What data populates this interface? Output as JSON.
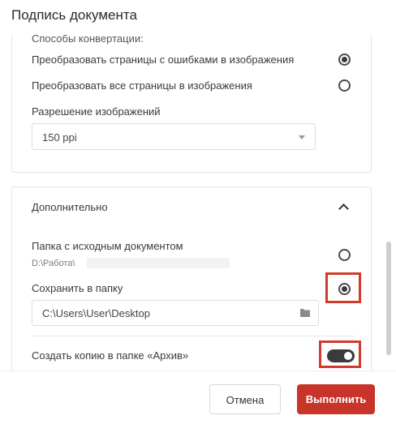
{
  "dialog": {
    "title": "Подпись документа"
  },
  "conversion": {
    "section_label": "Способы конвертации:",
    "option_errors": "Преобразовать страницы с ошибками в изображения",
    "option_errors_selected": true,
    "option_all": "Преобразовать все страницы в изображения",
    "option_all_selected": false,
    "resolution_label": "Разрешение изображений",
    "resolution_value": "150 ppi"
  },
  "additional": {
    "header": "Дополнительно",
    "expanded": true,
    "source_folder_label": "Папка с исходным документом",
    "source_folder_path": "D:\\Работа\\",
    "source_folder_selected": false,
    "save_to_folder_label": "Сохранить в папку",
    "save_to_folder_selected": true,
    "save_path": "C:\\Users\\User\\Desktop",
    "archive_copy_label": "Создать копию в папке «Архив»",
    "archive_copy_enabled": true
  },
  "buttons": {
    "cancel": "Отмена",
    "execute": "Выполнить"
  },
  "colors": {
    "accent": "#c8342a",
    "highlight": "#d33a2c",
    "toggle_on": "#3b3b3b"
  },
  "icons": {
    "dropdown": "caret-down-icon",
    "folder": "folder-icon",
    "collapse": "chevron-up-icon"
  }
}
